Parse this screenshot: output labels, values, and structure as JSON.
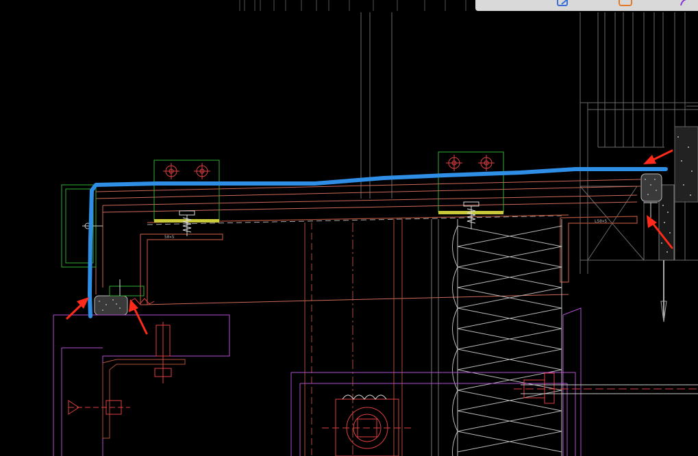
{
  "drawing": {
    "background": "#000000",
    "markup_color": "#2f8fe6",
    "arrow_color": "#ff2a1a",
    "dimension_labels": [
      "50×5",
      "L50×5"
    ]
  },
  "toolbar": {
    "icons": [
      "pencil-edit-icon",
      "comment-icon",
      "share-icon"
    ]
  }
}
